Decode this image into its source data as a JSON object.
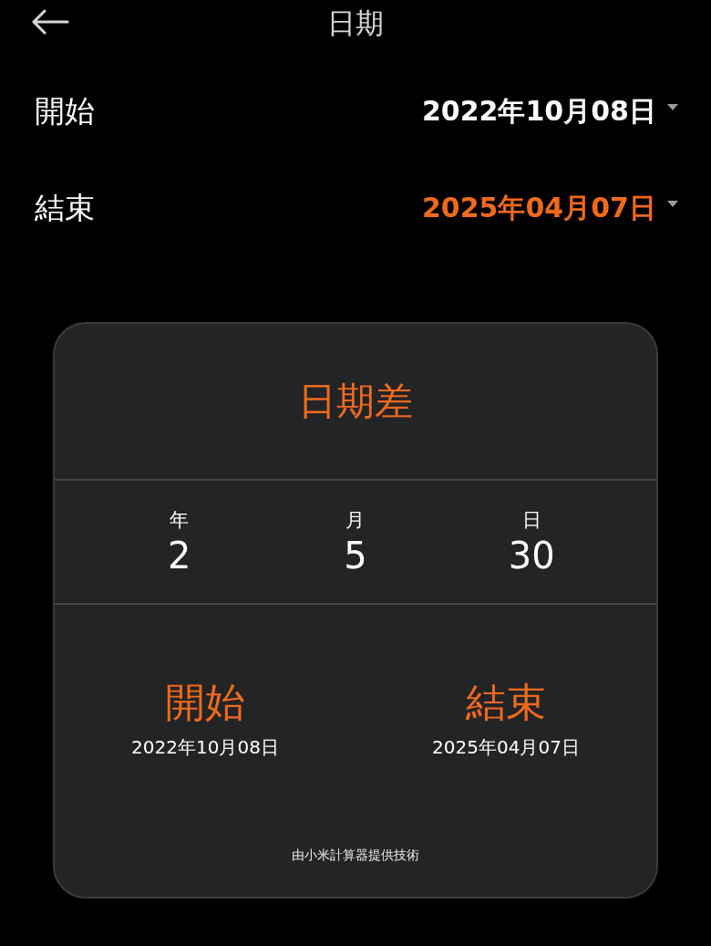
{
  "header": {
    "title": "日期"
  },
  "fields": [
    {
      "label": "開始",
      "value": "2022年10月08日",
      "selected": false
    },
    {
      "label": "結束",
      "value": "2025年04月07日",
      "selected": true
    }
  ],
  "card": {
    "title": "日期差",
    "difference": [
      {
        "label": "年",
        "value": "2"
      },
      {
        "label": "月",
        "value": "5"
      },
      {
        "label": "日",
        "value": "30"
      }
    ],
    "endpoints": [
      {
        "label": "開始",
        "date": "2022年10月08日"
      },
      {
        "label": "結束",
        "date": "2025年04月07日"
      }
    ],
    "footer": "由小米計算器提供技術"
  }
}
